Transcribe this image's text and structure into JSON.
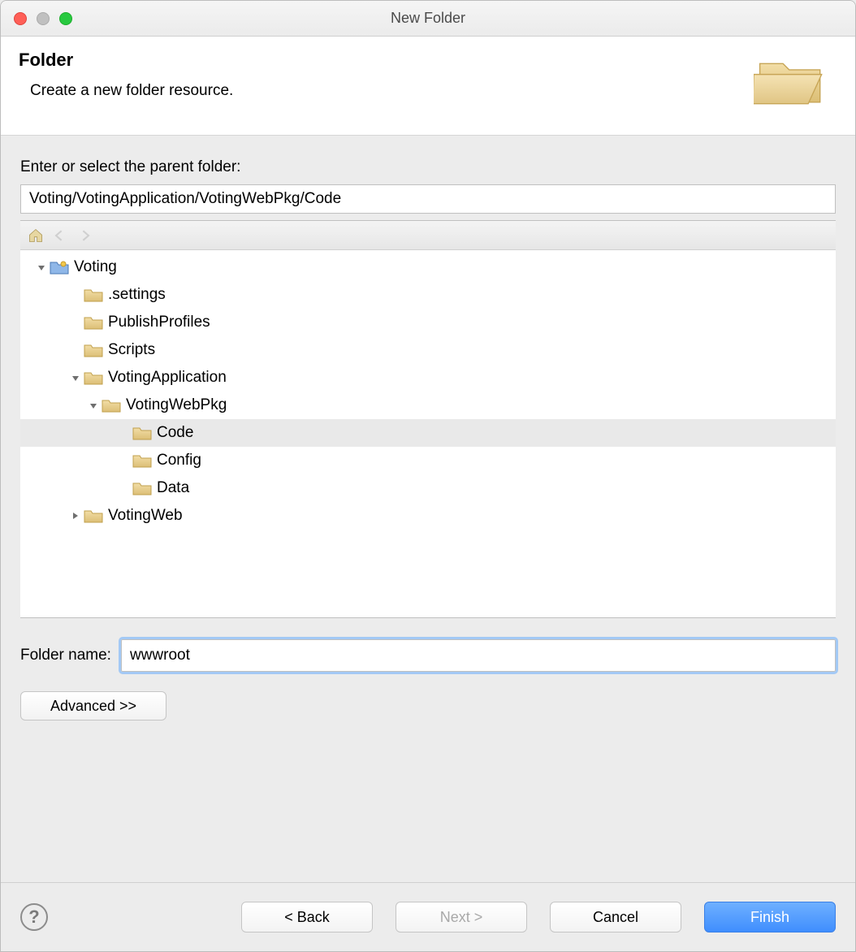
{
  "window": {
    "title": "New Folder"
  },
  "header": {
    "heading": "Folder",
    "subtitle": "Create a new folder resource."
  },
  "parent": {
    "label": "Enter or select the parent folder:",
    "path": "Voting/VotingApplication/VotingWebPkg/Code"
  },
  "tree": {
    "items": [
      {
        "id": "voting",
        "label": "Voting",
        "indent": 0,
        "disclosure": "open",
        "icon": "project",
        "selected": false
      },
      {
        "id": "settings",
        "label": ".settings",
        "indent": 1,
        "disclosure": "none",
        "icon": "folder",
        "selected": false
      },
      {
        "id": "publish",
        "label": "PublishProfiles",
        "indent": 1,
        "disclosure": "none",
        "icon": "folder",
        "selected": false
      },
      {
        "id": "scripts",
        "label": "Scripts",
        "indent": 1,
        "disclosure": "none",
        "icon": "folder",
        "selected": false
      },
      {
        "id": "votingapp",
        "label": "VotingApplication",
        "indent": 1,
        "disclosure": "open",
        "icon": "folder",
        "selected": false
      },
      {
        "id": "votingwebpkg",
        "label": "VotingWebPkg",
        "indent": 2,
        "disclosure": "open",
        "icon": "folder",
        "selected": false
      },
      {
        "id": "code",
        "label": "Code",
        "indent": 3,
        "disclosure": "none",
        "icon": "folder",
        "selected": true
      },
      {
        "id": "config",
        "label": "Config",
        "indent": 3,
        "disclosure": "none",
        "icon": "folder",
        "selected": false
      },
      {
        "id": "data",
        "label": "Data",
        "indent": 3,
        "disclosure": "none",
        "icon": "folder",
        "selected": false
      },
      {
        "id": "votingweb",
        "label": "VotingWeb",
        "indent": 1,
        "disclosure": "closed",
        "icon": "folder",
        "selected": false
      }
    ]
  },
  "folderName": {
    "label": "Folder name:",
    "value": "wwwroot"
  },
  "buttons": {
    "advanced": "Advanced >>",
    "back": "< Back",
    "next": "Next >",
    "cancel": "Cancel",
    "finish": "Finish"
  },
  "icons": {
    "home": "home-icon",
    "navBack": "arrow-left-icon",
    "navForward": "arrow-right-icon"
  }
}
